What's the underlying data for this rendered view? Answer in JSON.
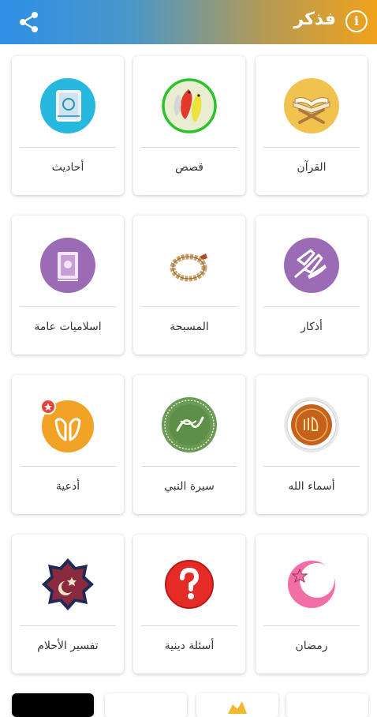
{
  "header": {
    "title": "فذكر",
    "info_symbol": "i",
    "colors": {
      "start": "#2e8fe6",
      "end": "#f0a21c"
    }
  },
  "cards": [
    {
      "label": "القرآن",
      "icon": "quran-book-stand-icon"
    },
    {
      "label": "قصص",
      "icon": "parrots-icon"
    },
    {
      "label": "أحاديث",
      "icon": "hadith-book-icon"
    },
    {
      "label": "أذكار",
      "icon": "praying-hands-icon"
    },
    {
      "label": "المسبحة",
      "icon": "prayer-beads-icon"
    },
    {
      "label": "اسلاميات عامة",
      "icon": "islamic-book-icon"
    },
    {
      "label": "أسماء الله",
      "icon": "allah-calligraphy-icon"
    },
    {
      "label": "سيرة النبي",
      "icon": "muhammad-calligraphy-icon"
    },
    {
      "label": "أدعية",
      "icon": "dua-hands-icon"
    },
    {
      "label": "رمضان",
      "icon": "crescent-star-icon"
    },
    {
      "label": "أسئلة دينية",
      "icon": "question-mark-icon"
    },
    {
      "label": "تفسير الأحلام",
      "icon": "dream-interpretation-icon"
    }
  ]
}
